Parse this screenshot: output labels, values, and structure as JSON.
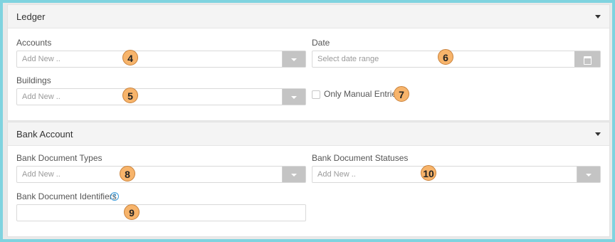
{
  "ledger": {
    "title": "Ledger",
    "accounts_label": "Accounts",
    "accounts_placeholder": "Add New ..",
    "date_label": "Date",
    "date_placeholder": "Select date range",
    "buildings_label": "Buildings",
    "buildings_placeholder": "Add New ..",
    "manual_entries_label": "Only Manual Entries"
  },
  "bank_account": {
    "title": "Bank Account",
    "doc_types_label": "Bank Document Types",
    "doc_types_placeholder": "Add New ..",
    "doc_statuses_label": "Bank Document Statuses",
    "doc_statuses_placeholder": "Add New ..",
    "doc_identifiers_label": "Bank Document Identifiers",
    "doc_identifiers_value": ""
  },
  "annotations": [
    "4",
    "5",
    "6",
    "7",
    "8",
    "9",
    "10"
  ],
  "icons": {
    "collapse": "caret-down-icon",
    "dropdown": "chevron-down-icon",
    "calendar": "calendar-icon",
    "help": "question-circle-icon"
  },
  "colors": {
    "background": "#7fd3df",
    "badge": "#f7b46b",
    "button": "#c4c4c4",
    "help": "#3a9ad9"
  }
}
